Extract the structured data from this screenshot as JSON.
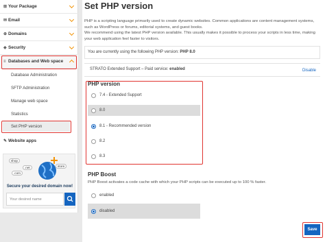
{
  "sidebar": {
    "your_package": "Your Package",
    "email": "Email",
    "domains": "Domains",
    "security": "Security",
    "databases": "Databases and Web space",
    "sub_items": [
      "Database Administration",
      "SFTP Administration",
      "Manage web space",
      "Statistics",
      "Set PHP version"
    ],
    "website_apps": "Website apps",
    "domain_widget": {
      "title": "Secure your desired domain now!",
      "placeholder": "Your desired name",
      "tags": [
        "shop",
        ".net",
        ".com",
        "store"
      ]
    }
  },
  "main": {
    "title": "Set PHP version",
    "intro1": "PHP is a scripting language primarily used to create dynamic websites. Common applications are content management systems, such as WordPress or forums, editorial systems, and guest books.",
    "intro2": "We recommend using the latest PHP version available. This usually makes it possible to process your scripts in less time, making your web application feel faster to visitors.",
    "current_prefix": "You are currently using the following PHP version: ",
    "current_version": "PHP 8.0",
    "support_prefix": "STRATO Extended Support – Paid service: ",
    "support_status": "enabled",
    "disable_link": "Disable",
    "php_version_title": "PHP version",
    "versions": [
      {
        "label": "7.4 - Extended Support",
        "checked": false
      },
      {
        "label": "8.0",
        "checked": false
      },
      {
        "label": "8.1 - Recommended version",
        "checked": true
      },
      {
        "label": "8.2",
        "checked": false
      },
      {
        "label": "8.3",
        "checked": false
      }
    ],
    "boost_title": "PHP Boost",
    "boost_desc": "PHP Boost activates a code cache with which your PHP scripts can be executed up to 100 % faster.",
    "boost_options": [
      {
        "label": "enabled",
        "checked": false
      },
      {
        "label": "disabled",
        "checked": true
      }
    ],
    "save_label": "Save"
  },
  "colors": {
    "accent": "#1565c0",
    "highlight": "#e0332f",
    "chevron": "#f39200"
  }
}
